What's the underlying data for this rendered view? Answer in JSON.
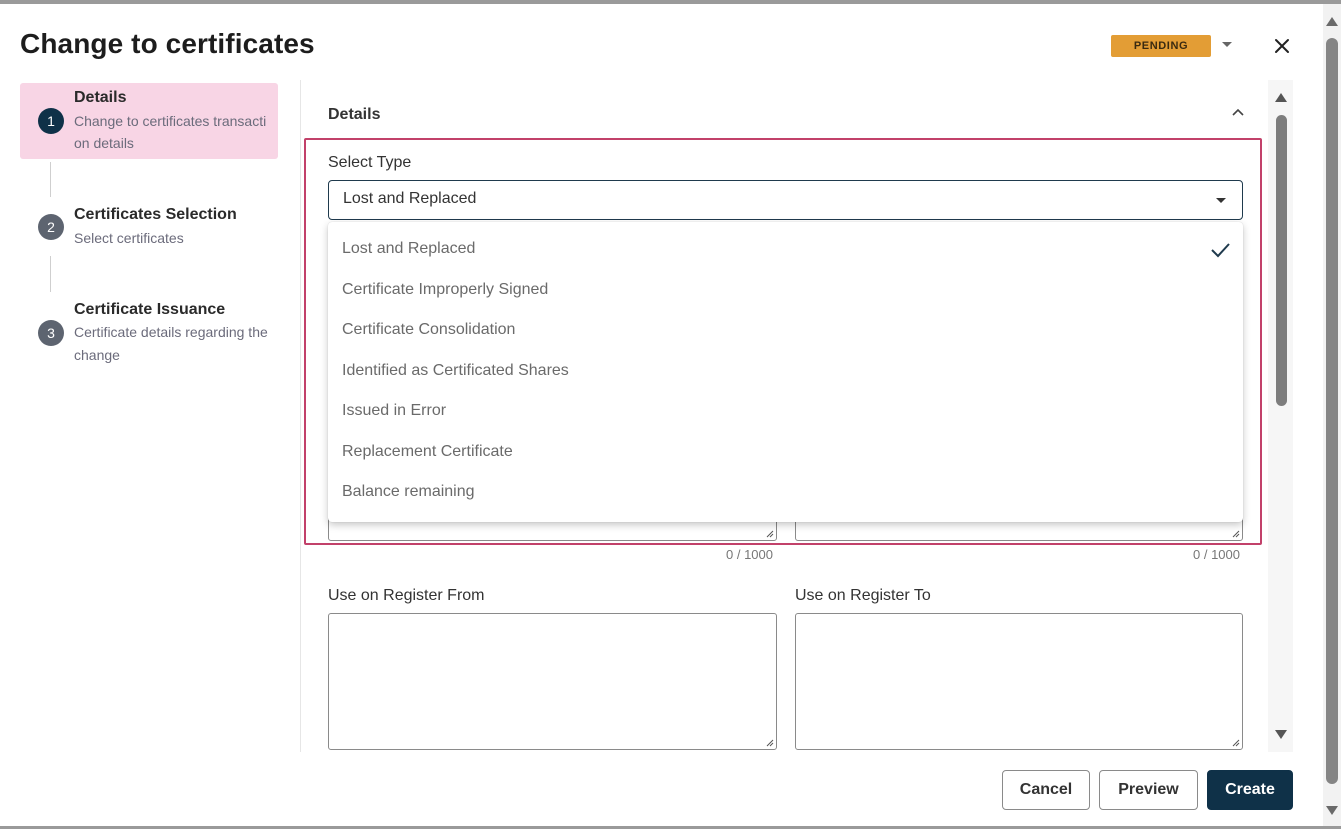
{
  "dialog": {
    "title": "Change to certificates",
    "status": "PENDING",
    "status_color": "#e39d35",
    "close_icon": "close-icon",
    "status_menu_icon": "caret-down-icon"
  },
  "stepper": {
    "steps": [
      {
        "number": "1",
        "title": "Details",
        "subtitle_line1": "Change to certificates transacti",
        "subtitle_line2": "on details",
        "active": true
      },
      {
        "number": "2",
        "title": "Certificates Selection",
        "subtitle_line1": "Select certificates",
        "subtitle_line2": "",
        "active": false
      },
      {
        "number": "3",
        "title": "Certificate Issuance",
        "subtitle_line1": "Certificate details regarding the",
        "subtitle_line2": "change",
        "active": false
      }
    ],
    "active_bg": "#f8d5e5",
    "active_circle": "#0f3148",
    "inactive_circle": "#5d6470"
  },
  "details": {
    "section_title": "Details",
    "collapse_icon": "chevron-up-icon",
    "select_type": {
      "label": "Select Type",
      "value": "Lost and Replaced",
      "options": [
        "Lost and Replaced",
        "Certificate Improperly Signed",
        "Certificate Consolidation",
        "Identified as Certificated Shares",
        "Issued in Error",
        "Replacement Certificate",
        "Balance remaining"
      ],
      "selected_icon": "check-icon"
    },
    "counters": {
      "left": "0 / 1000",
      "right": "0 / 1000"
    },
    "register_from": {
      "label": "Use on Register From",
      "value": ""
    },
    "register_to": {
      "label": "Use on Register To",
      "value": ""
    }
  },
  "footer": {
    "cancel": "Cancel",
    "preview": "Preview",
    "create": "Create"
  },
  "colors": {
    "highlight_border": "#c2416a",
    "primary_button": "#0f3148"
  }
}
